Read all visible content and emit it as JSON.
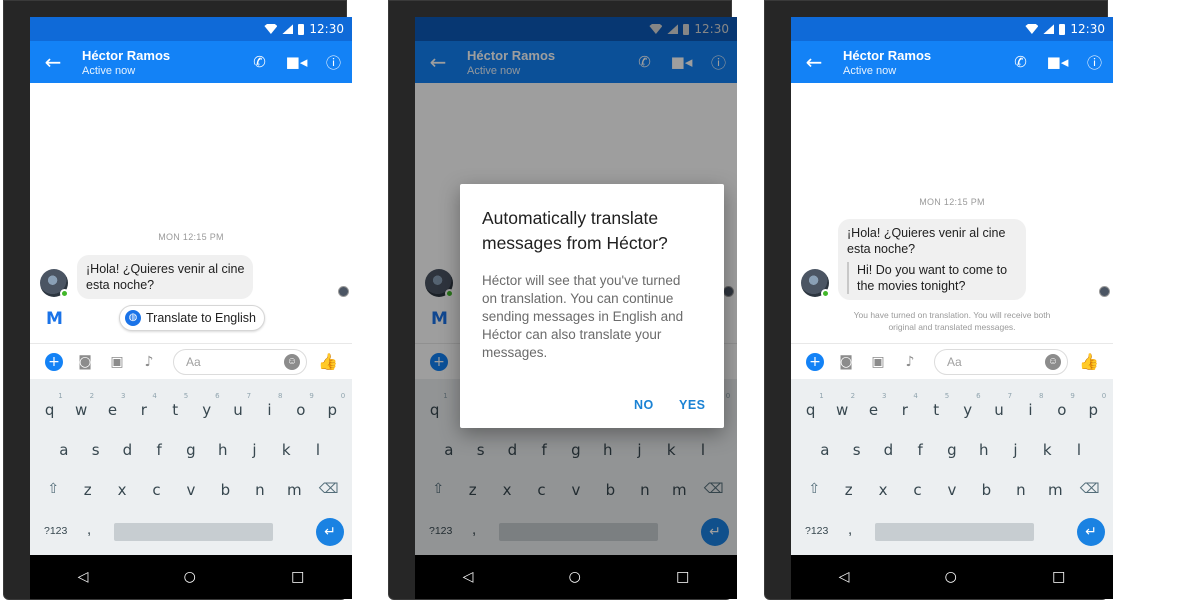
{
  "status": {
    "time": "12:30"
  },
  "header": {
    "contact_name": "Héctor Ramos",
    "presence": "Active now"
  },
  "chat": {
    "timestamp": "MON 12:15 PM",
    "message_line1": "¡Hola! ¿Quieres venir al cine",
    "message_line2": "esta noche?",
    "translation_line1": "Hi! Do you want to come to",
    "translation_line2": "the movies tonight?",
    "translate_chip": "Translate to English",
    "translation_notice_line1": "You have turned on translation. You will receive both",
    "translation_notice_line2": "original and translated messages."
  },
  "composer": {
    "placeholder": "Aa"
  },
  "keyboard": {
    "row1": [
      "q",
      "w",
      "e",
      "r",
      "t",
      "y",
      "u",
      "i",
      "o",
      "p"
    ],
    "row1_hints": [
      "1",
      "2",
      "3",
      "4",
      "5",
      "6",
      "7",
      "8",
      "9",
      "0"
    ],
    "row2": [
      "a",
      "s",
      "d",
      "f",
      "g",
      "h",
      "j",
      "k",
      "l"
    ],
    "row3": [
      "z",
      "x",
      "c",
      "v",
      "b",
      "n",
      "m"
    ],
    "symbols_key": "?123",
    "comma_key": ","
  },
  "dialog": {
    "title_line1": "Automatically translate",
    "title_line2": "messages from Héctor?",
    "body_line1": "Héctor will see that you've turned",
    "body_line2": "on translation. You can continue",
    "body_line3": "sending messages in English and",
    "body_line4": "Héctor can also translate your",
    "body_line5": "messages.",
    "no_label": "NO",
    "yes_label": "YES"
  },
  "icons": {
    "back": "arrow-left-icon",
    "call": "phone-icon",
    "video": "video-camera-icon",
    "info": "info-icon",
    "add": "plus-icon",
    "camera": "camera-icon",
    "gallery": "image-icon",
    "mic": "microphone-icon",
    "emoji": "emoji-icon",
    "like": "thumbs-up-icon",
    "assistant": "m-assistant-icon",
    "translate": "globe-icon",
    "shift": "shift-icon",
    "backspace": "backspace-icon",
    "enter": "enter-icon",
    "nav_back": "triangle-back-icon",
    "nav_home": "circle-home-icon",
    "nav_recents": "square-recents-icon"
  },
  "colors": {
    "header_blue": "#1382f6",
    "statusbar_blue": "#0f6ad8",
    "accent_blue": "#1a73e8",
    "online_green": "#42b72a"
  }
}
